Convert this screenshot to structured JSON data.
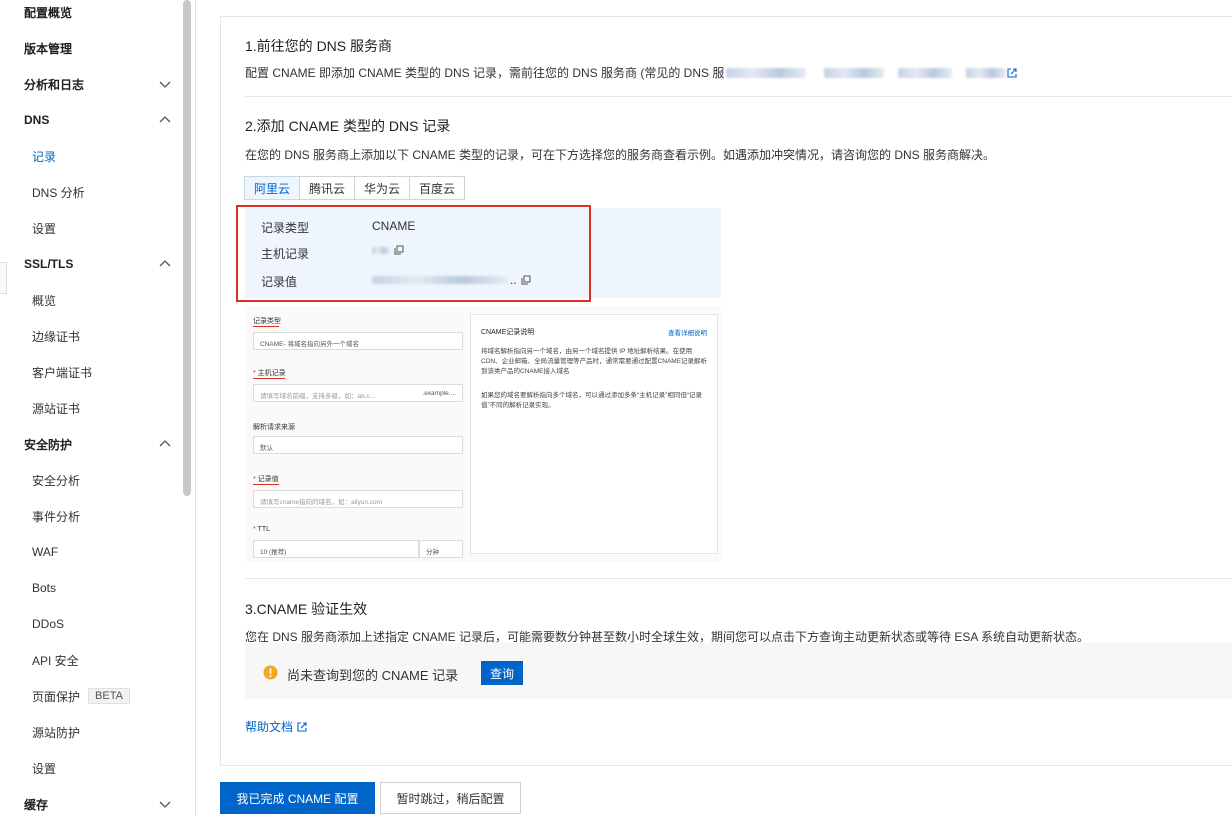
{
  "sidebar": {
    "items": [
      {
        "label": "配置概览"
      },
      {
        "label": "版本管理"
      },
      {
        "label": "分析和日志"
      },
      {
        "label": "DNS"
      },
      {
        "label": "记录"
      },
      {
        "label": "DNS 分析"
      },
      {
        "label": "设置"
      },
      {
        "label": "SSL/TLS"
      },
      {
        "label": "概览"
      },
      {
        "label": "边缘证书"
      },
      {
        "label": "客户端证书"
      },
      {
        "label": "源站证书"
      },
      {
        "label": "安全防护"
      },
      {
        "label": "安全分析"
      },
      {
        "label": "事件分析"
      },
      {
        "label": "WAF"
      },
      {
        "label": "Bots"
      },
      {
        "label": "DDoS"
      },
      {
        "label": "API 安全"
      },
      {
        "label": "页面保护"
      },
      {
        "label": "源站防护"
      },
      {
        "label": "设置"
      },
      {
        "label": "缓存"
      }
    ],
    "beta_badge": "BETA"
  },
  "step1": {
    "title": "1.前往您的 DNS 服务商",
    "desc": "配置 CNAME 即添加 CNAME 类型的 DNS 记录，需前往您的 DNS 服务商 (常见的 DNS 服"
  },
  "step2": {
    "title": "2.添加 CNAME 类型的 DNS 记录",
    "desc": "在您的 DNS 服务商上添加以下 CNAME 类型的记录，可在下方选择您的服务商查看示例。如遇添加冲突情况，请咨询您的 DNS 服务商解决。",
    "tabs": [
      "阿里云",
      "腾讯云",
      "华为云",
      "百度云"
    ],
    "record": {
      "type_label": "记录类型",
      "type_value": "CNAME",
      "host_label": "主机记录",
      "value_label": "记录值",
      "value_suffix": ".."
    },
    "mock": {
      "f_type": "记录类型",
      "f_type_val": "CNAME- 将域名指向另外一个域名",
      "f_host": "主机记录",
      "f_host_ph": "请填写域名前缀，支持多级，如：ab.c...",
      "f_host_suffix": ".example....",
      "f_source": "解析请求来源",
      "f_source_val": "默认",
      "f_value": "记录值",
      "f_value_ph": "请填写cname指向的域名，如：aliyun.com",
      "f_ttl": "TTL",
      "f_ttl_val": "10 (推荐)",
      "f_ttl_unit": "分钟",
      "help_title": "CNAME记录说明",
      "help_link": "查看详细说明",
      "help_p1": "将域名解析指向另一个域名，由另一个域名提供 IP 地址解析结果。在使用CDN、企业邮箱、全局流量管理等产品时，通常需要通过配置CNAME记录解析到该类产品的CNAME接入域名",
      "help_p2": "如果您的域名要解析指向多个域名，可以通过添加多条“主机记录”相同但“记录值”不同的解析记录实现。"
    }
  },
  "step3": {
    "title": "3.CNAME 验证生效",
    "desc": "您在 DNS 服务商添加上述指定 CNAME 记录后，可能需要数分钟甚至数小时全球生效，期间您可以点击下方查询主动更新状态或等待 ESA 系统自动更新状态。",
    "status": "尚未查询到您的 CNAME 记录",
    "query_label": "查询"
  },
  "help_doc": "帮助文档",
  "footer": {
    "done_label": "我已完成 CNAME 配置",
    "skip_label": "暂时跳过，稍后配置"
  },
  "colors": {
    "accent": "#0064c8",
    "warning": "#f5a623",
    "highlight": "#d93026"
  }
}
